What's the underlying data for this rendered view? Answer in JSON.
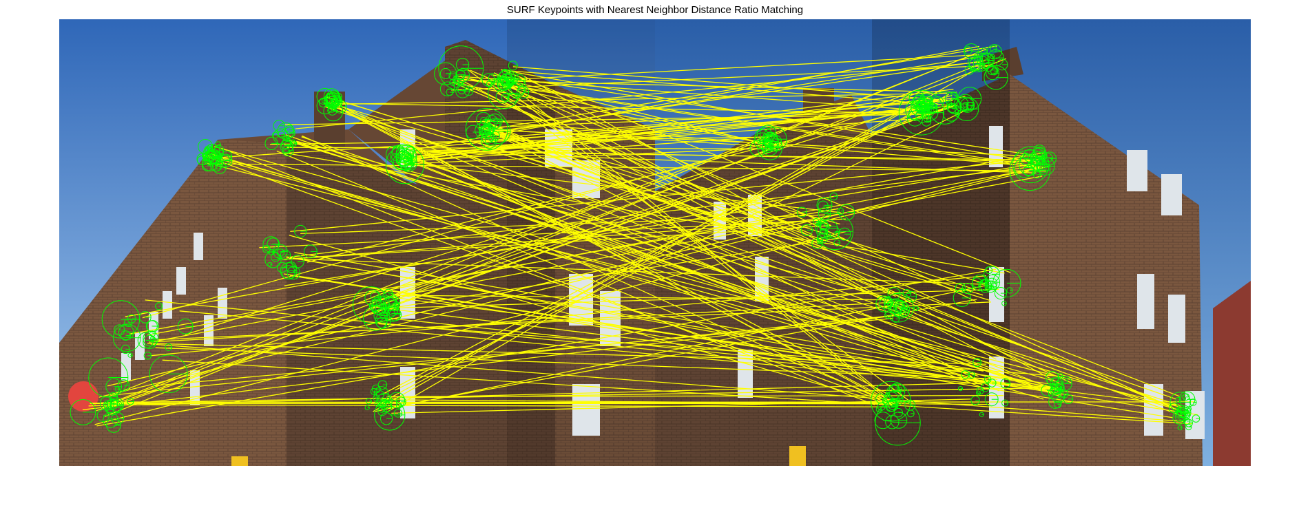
{
  "figure": {
    "title": "SURF Keypoints with Nearest Neighbor Distance Ratio Matching"
  },
  "colors": {
    "background": "#ffffff",
    "sky_top": "#2f67b8",
    "sky_bottom": "#9cc6ee",
    "brick": "#5e4333",
    "brick_dark": "#3f2c22",
    "brick_light": "#8a6247",
    "window": "#e8ecef",
    "match_line": "#ffff00",
    "keypoint": "#00ff00",
    "sign_red": "#e2453e"
  },
  "images": {
    "left": {
      "label": "left-photo",
      "depicts": "brick-building-corner"
    },
    "right": {
      "label": "right-photo",
      "depicts": "brick-building-corner"
    }
  }
}
